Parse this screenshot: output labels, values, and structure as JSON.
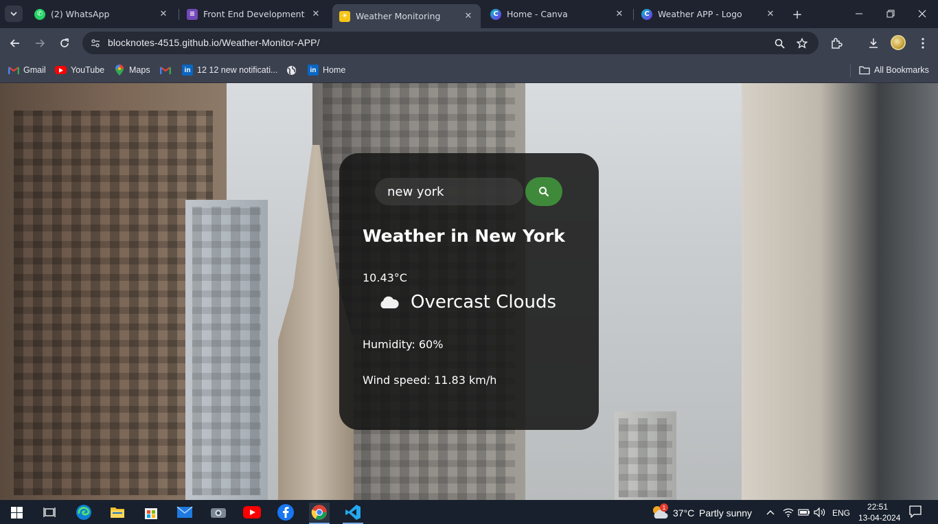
{
  "browser": {
    "tabs": [
      {
        "title": "(2) WhatsApp",
        "favicon": "whatsapp-icon",
        "active": false
      },
      {
        "title": "Front End Development Usin",
        "favicon": "forms-icon",
        "active": false
      },
      {
        "title": "Weather Monitoring",
        "favicon": "sun-icon",
        "active": true
      },
      {
        "title": "Home - Canva",
        "favicon": "canva-icon",
        "active": false
      },
      {
        "title": "Weather APP - Logo",
        "favicon": "canva-icon",
        "active": false
      }
    ],
    "url": "blocknotes-4515.github.io/Weather-Monitor-APP/",
    "bookmarks": [
      {
        "label": "Gmail",
        "icon": "gmail-icon"
      },
      {
        "label": "YouTube",
        "icon": "youtube-icon"
      },
      {
        "label": "Maps",
        "icon": "maps-icon"
      },
      {
        "label": "",
        "icon": "gmail-icon"
      },
      {
        "label": "12 12 new notificati...",
        "icon": "linkedin-icon"
      },
      {
        "label": "",
        "icon": "globe-icon"
      },
      {
        "label": "Home",
        "icon": "linkedin-icon"
      }
    ],
    "all_bookmarks_label": "All Bookmarks"
  },
  "weather": {
    "search_value": "new york",
    "city_heading": "Weather in New York",
    "temperature": "10.43°C",
    "condition": "Overcast Clouds",
    "humidity": "Humidity: 60%",
    "wind": "Wind speed: 11.83 km/h"
  },
  "taskbar": {
    "weather_temp": "37°C",
    "weather_desc": "Partly sunny",
    "language": "ENG",
    "time": "22:51",
    "date": "13-04-2024",
    "weather_badge": "1"
  },
  "colors": {
    "search_button": "#3f8a3a",
    "card_background": "#141414",
    "browser_chrome": "#3c4150"
  }
}
